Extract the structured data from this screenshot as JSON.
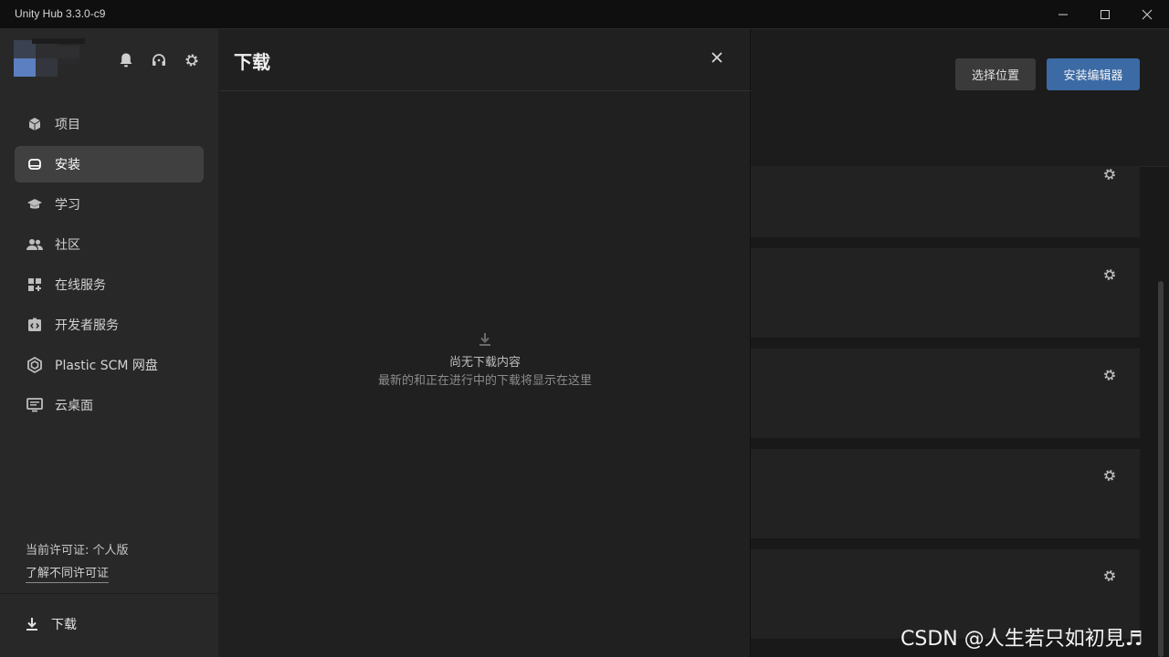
{
  "window": {
    "title": "Unity Hub 3.3.0-c9"
  },
  "sidebar": {
    "items": [
      {
        "label": "项目",
        "icon": "cube-icon"
      },
      {
        "label": "安装",
        "icon": "drive-icon",
        "active": true
      },
      {
        "label": "学习",
        "icon": "graduation-cap-icon"
      },
      {
        "label": "社区",
        "icon": "people-icon"
      },
      {
        "label": "在线服务",
        "icon": "grid-plus-icon"
      },
      {
        "label": "开发者服务",
        "icon": "code-box-icon"
      },
      {
        "label": "Plastic SCM 网盘",
        "icon": "hexagon-icon"
      },
      {
        "label": "云桌面",
        "icon": "monitor-icon"
      }
    ],
    "license_text": "当前许可证: 个人版",
    "license_link": "了解不同许可证",
    "download_label": "下载"
  },
  "downloads_panel": {
    "title": "下载",
    "empty_title": "尚无下载内容",
    "empty_desc": "最新的和正在进行中的下载将显示在这里"
  },
  "installs": {
    "locate_button": "选择位置",
    "install_button": "安装编辑器",
    "card_count": 5
  },
  "watermark": "CSDN @人生若只如初見♬",
  "colors": {
    "accent": "#3b6aa5",
    "active_nav": "#404040"
  }
}
